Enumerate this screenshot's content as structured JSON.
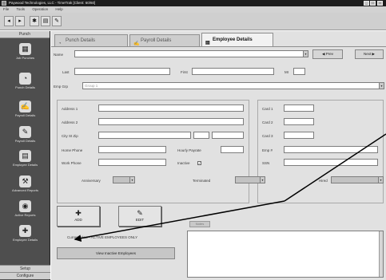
{
  "window": {
    "title": "Paywood Technologies, LLC - TimeTrak [Client: 60/60]",
    "min": "_",
    "max": "□",
    "close": "×"
  },
  "menu": [
    "File",
    "Tools",
    "Operation",
    "Help"
  ],
  "toolbar": [
    "◂",
    "▸",
    "✱",
    "▤",
    "✎"
  ],
  "sidebar": {
    "header": "Punch",
    "items": [
      {
        "label": "Job Punches",
        "icon": "▦"
      },
      {
        "label": "Punch Details",
        "icon": "◔"
      },
      {
        "label": "Payroll Details",
        "icon": "✍"
      },
      {
        "label": "Payroll Details",
        "icon": "✎"
      },
      {
        "label": "Employee Details",
        "icon": "▤"
      },
      {
        "label": "Advanced Reports",
        "icon": "⚒"
      },
      {
        "label": "Active Reports",
        "icon": "◉"
      },
      {
        "label": "Employee Details",
        "icon": "✚"
      }
    ],
    "footer1": "Setup",
    "footer2": "Configure"
  },
  "tabs": [
    {
      "label": "Punch Details",
      "icon": "◔"
    },
    {
      "label": "Payroll Details",
      "icon": "✍"
    },
    {
      "label": "Employee Details",
      "icon": "▤"
    }
  ],
  "form": {
    "name_label": "Name",
    "name_value": "",
    "prev_label": "◀ Prev",
    "next_label": "Next ▶",
    "last_label": "Last",
    "first_label": "First",
    "mi_label": "MI",
    "emp_grp_label": "Emp Grp",
    "emp_grp_value": "Group 1",
    "address1_label": "Address 1",
    "address2_label": "Address 2",
    "city_label": "City St Zip",
    "home_phone_label": "Home Phone",
    "work_phone_label": "Work Phone",
    "hourly_label": "Hourly Payrate",
    "inactive_label": "Inactive",
    "inactive_checked": "✓",
    "card1_label": "Card 1",
    "card2_label": "Card 2",
    "card3_label": "Card 3",
    "emp_num_label": "Emp #",
    "ssn_label": "SSN",
    "anniversary_label": "Anniversary",
    "terminated_label": "Terminated",
    "hired_label": "Hired"
  },
  "actions": {
    "add_label": "ADD",
    "add_icon": "✚",
    "edit_label": "EDIT",
    "edit_icon": "✎",
    "status_text": "Current View - ACTIVE EMPLOYEES ONLY",
    "view_inactive_label": "View Inactive Employees",
    "notes_label": "Notes"
  }
}
